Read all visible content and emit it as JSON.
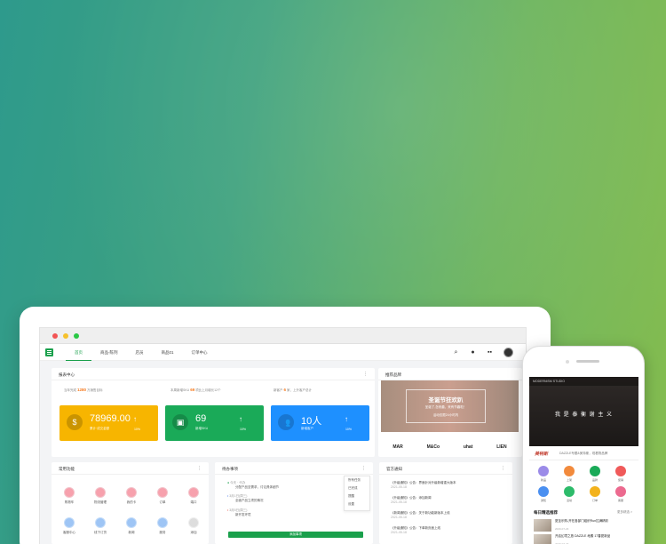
{
  "nav": {
    "items": [
      "首页",
      "商品-陈列",
      "店员",
      "商品01",
      "订单中心"
    ],
    "active_index": 0
  },
  "report": {
    "title": "报表中心",
    "stats": [
      {
        "prefix": "当年完成",
        "value": "1280",
        "suffix": "万销售目标"
      },
      {
        "prefix": "本周新增SKU",
        "value": "69",
        "suffix": "项比上月增长12个"
      },
      {
        "prefix": "新客户",
        "value": "6",
        "suffix": "家，上升客户总计"
      }
    ],
    "tiles": [
      {
        "value": "78969.00",
        "label": "累计·成交金额",
        "arrow": "↑",
        "pct": "10%",
        "icon": "$",
        "color": "#f7b500"
      },
      {
        "value": "69",
        "label": "新增SKU",
        "arrow": "↑",
        "pct": "10%",
        "icon": "▣",
        "color": "#1aaa58"
      },
      {
        "value": "10人",
        "label": "新增客户",
        "arrow": "↑",
        "pct": "10%",
        "icon": "👥",
        "color": "#1e90ff"
      }
    ]
  },
  "brands": {
    "title": "推荐品牌",
    "banner_title": "圣诞节狂欢趴",
    "banner_sub": "圣诞了,怎来趣，来有节趣啦！",
    "banner_sub2": "活动仅限24小时内",
    "logos": [
      "MAR",
      "M&Co",
      "uhat",
      "LIEN"
    ]
  },
  "functions": {
    "title": "常用功能",
    "items": [
      "购物车",
      "物流管理",
      "我的卡",
      "订单",
      "端口",
      "客服中心",
      "线下订货",
      "新闻",
      "服务",
      "添加"
    ]
  },
  "todo": {
    "title": "待办事项",
    "items": [
      {
        "date": "今天 · 代办",
        "text": "分配产品至需求，讨论具体细节"
      },
      {
        "date": "3月1日(周三)",
        "text": "全面产品立项的情况"
      },
      {
        "date": "3月5日(周三)",
        "text": "新开发环境"
      }
    ],
    "menu": [
      "所有任务",
      "已完成",
      "提醒",
      "设置"
    ],
    "button": "添加事项"
  },
  "notices": {
    "title": "官方通知",
    "items": [
      {
        "text": "《升级通知》公告：界面针对升级新增重大版本",
        "date": "2021-05-18"
      },
      {
        "text": "《升级通知》公告：添加新闻",
        "date": "2021-05-18"
      },
      {
        "text": "《新闻通知》公告：关于新功能新版本上线",
        "date": "2021-05-18"
      },
      {
        "text": "《升级通知》公告：下单新页面上线",
        "date": "2021-05-18"
      }
    ]
  },
  "phone": {
    "header": "MODERNISM STUDIO",
    "slogan": "我 是 泰 衡 谢 主 义",
    "brand": "美特斯",
    "brand_desc": "DAZZLE专题&美特斯，现看物品牌",
    "icons": [
      {
        "label": "新品",
        "color": "#9b8be8"
      },
      {
        "label": "上架",
        "color": "#f28a3c"
      },
      {
        "label": "品牌",
        "color": "#1aaa58"
      },
      {
        "label": "促销",
        "color": "#f05a5a"
      },
      {
        "label": "通知",
        "color": "#4a8ff0"
      },
      {
        "label": "活动",
        "color": "#2dbb6a"
      },
      {
        "label": "订单",
        "color": "#f3b21c"
      },
      {
        "label": "客服",
        "color": "#ec6a8f"
      }
    ],
    "section": "每日精选推荐",
    "more": "更多精选 >",
    "list": [
      {
        "title": "夏至乐购-开在各部门组织Run拉满精彩",
        "date": "2020-07-23"
      },
      {
        "title": "开启幻境之旅 DAZZLE 地素 17春夏新品",
        "date": "2020-07-23"
      }
    ]
  }
}
